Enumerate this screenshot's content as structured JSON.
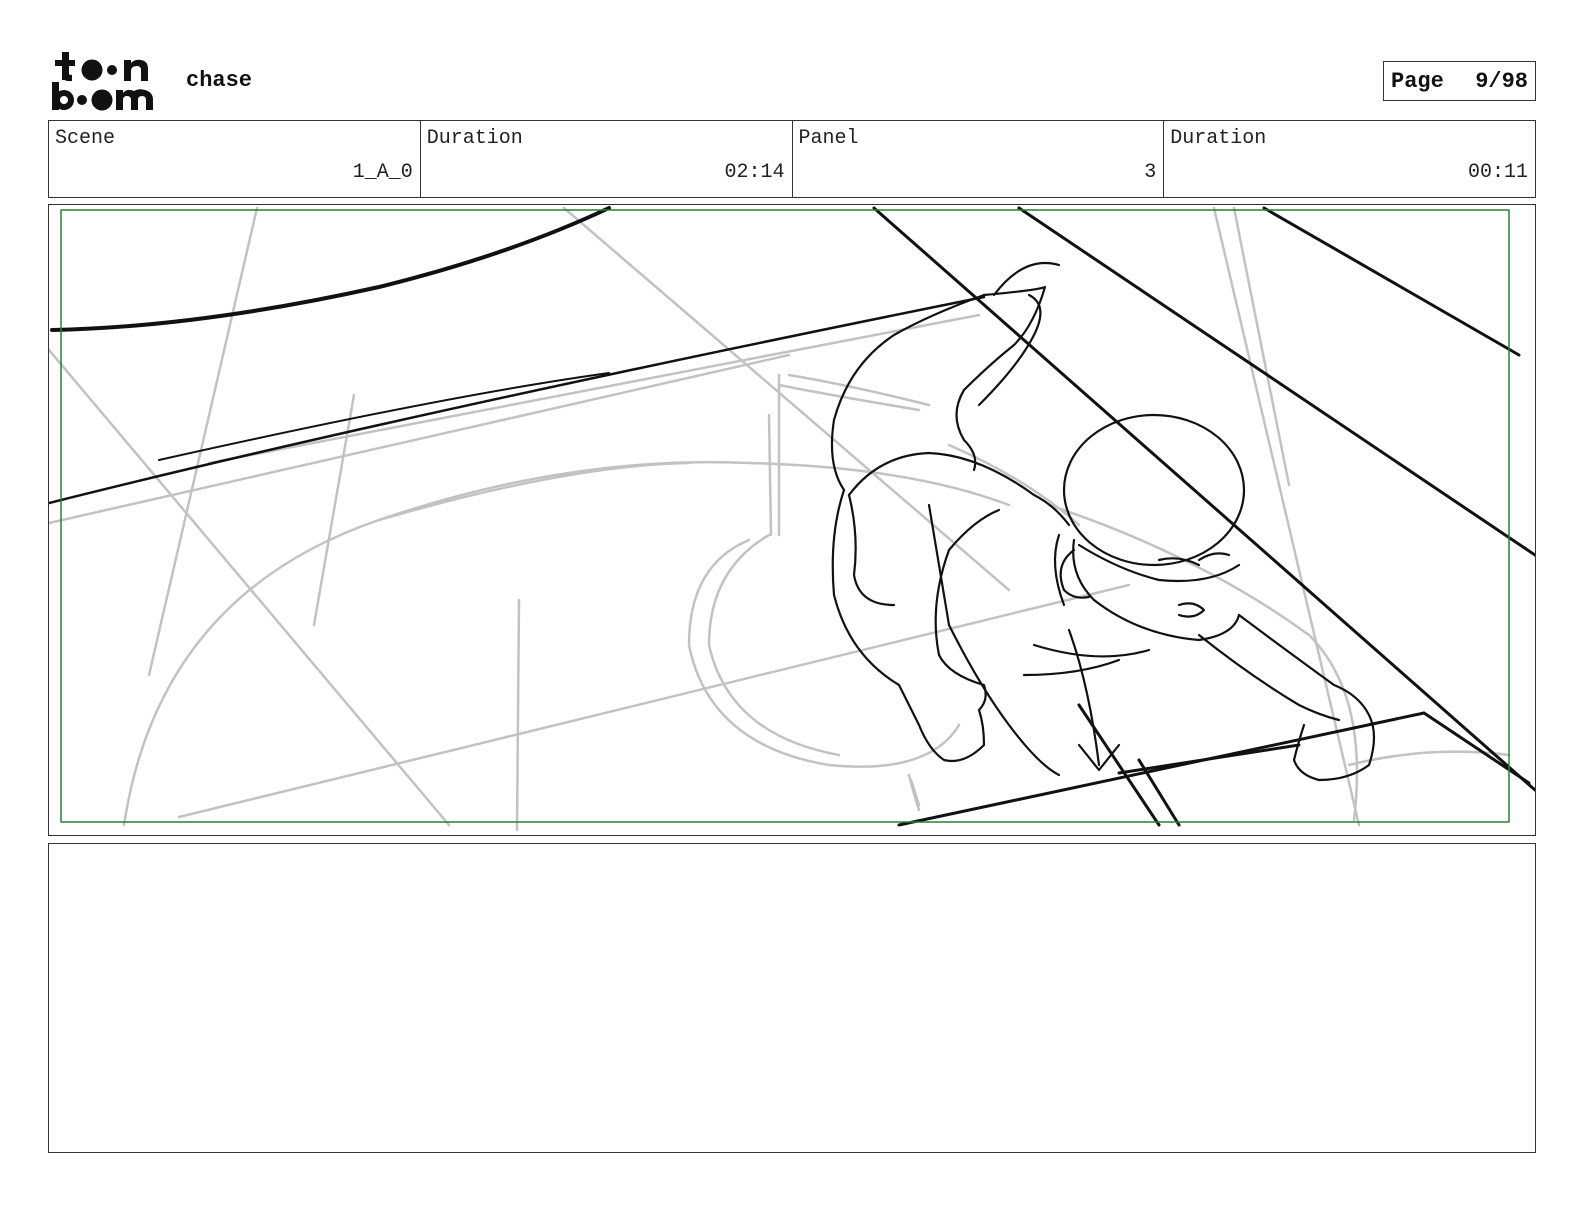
{
  "logo": {
    "text_line1": "toon",
    "text_line2": "boom",
    "icon": "toonboom-logo-icon"
  },
  "project": {
    "title": "chase"
  },
  "page": {
    "label": "Page",
    "number": "9/98"
  },
  "info": {
    "scene_label": "Scene",
    "scene_value": "1_A_0",
    "scene_duration_label": "Duration",
    "scene_duration_value": "02:14",
    "panel_label": "Panel",
    "panel_value": "3",
    "panel_duration_label": "Duration",
    "panel_duration_value": "00:11"
  },
  "panel": {
    "safe_frame_color": "#2e7d32",
    "sketch_dark_color": "#111111",
    "sketch_light_color": "#b8b8b8"
  },
  "notes": {
    "text": ""
  }
}
